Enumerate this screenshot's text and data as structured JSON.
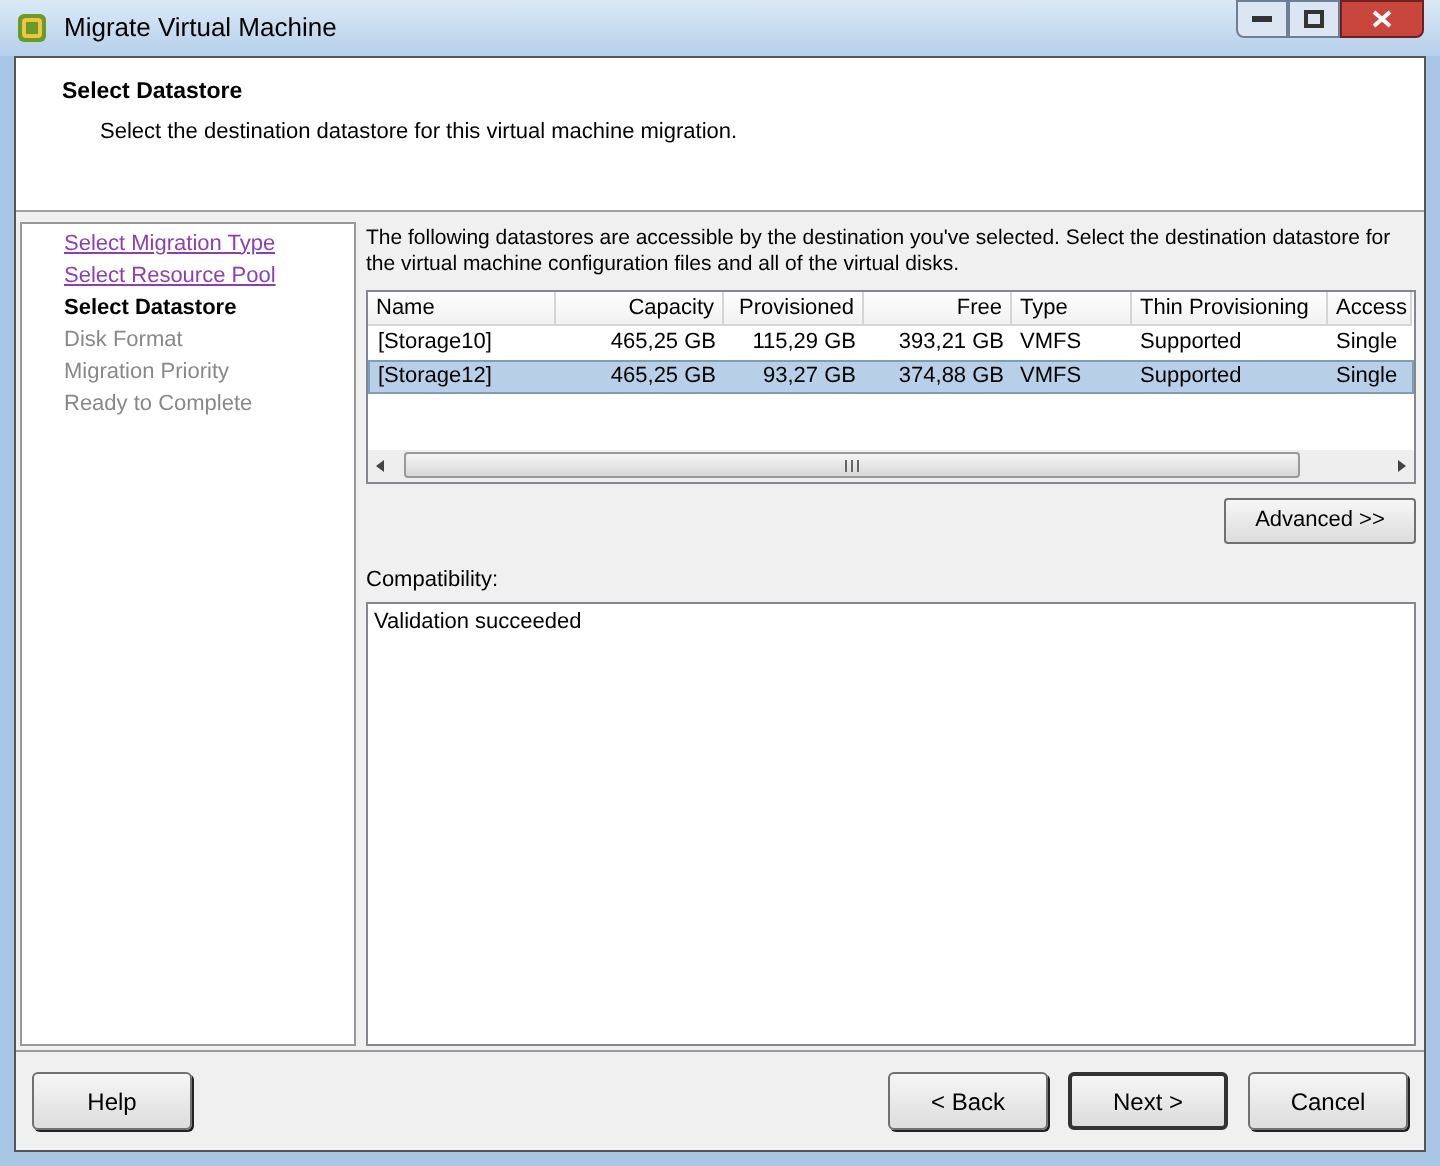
{
  "window": {
    "title": "Migrate Virtual Machine"
  },
  "header": {
    "title": "Select Datastore",
    "subtitle": "Select the destination datastore for this virtual machine migration."
  },
  "steps": [
    {
      "label": "Select Migration Type",
      "kind": "link",
      "selected": false
    },
    {
      "label": "Select Resource Pool",
      "kind": "link",
      "selected": false
    },
    {
      "label": "Select Datastore",
      "kind": "current",
      "selected": true
    },
    {
      "label": "Disk Format",
      "kind": "pending",
      "selected": false
    },
    {
      "label": "Migration Priority",
      "kind": "pending",
      "selected": false
    },
    {
      "label": "Ready to Complete",
      "kind": "pending",
      "selected": false
    }
  ],
  "intro": "The following datastores are accessible by the destination you've selected. Select the destination datastore for the virtual machine configuration files and all of the virtual disks.",
  "table": {
    "columns": [
      "Name",
      "Capacity",
      "Provisioned",
      "Free",
      "Type",
      "Thin Provisioning",
      "Access"
    ],
    "rows": [
      {
        "cells": [
          "[Storage10]",
          "465,25 GB",
          "115,29 GB",
          "393,21 GB",
          "VMFS",
          "Supported",
          "Single"
        ],
        "selected": false
      },
      {
        "cells": [
          "[Storage12]",
          "465,25 GB",
          "93,27 GB",
          "374,88 GB",
          "VMFS",
          "Supported",
          "Single"
        ],
        "selected": true
      }
    ]
  },
  "advanced_button": "Advanced >>",
  "compatibility": {
    "label": "Compatibility:",
    "message": "Validation succeeded"
  },
  "buttons": {
    "help": "Help",
    "back": "< Back",
    "next": "Next >",
    "cancel": "Cancel"
  }
}
